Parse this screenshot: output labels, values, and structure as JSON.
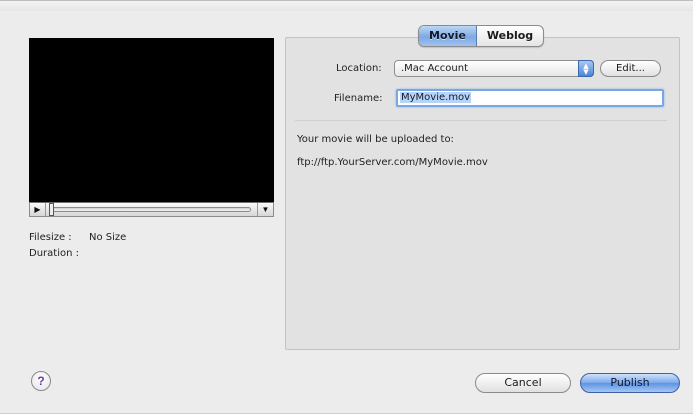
{
  "tabs": [
    {
      "label": "Movie",
      "active": true
    },
    {
      "label": "Weblog",
      "active": false
    }
  ],
  "preview": {
    "play_icon": "play-icon",
    "menu_icon": "triangle-down-icon",
    "filesize_label": "Filesize :",
    "filesize_value": "No Size",
    "duration_label": "Duration :",
    "duration_value": ""
  },
  "form": {
    "location_label": "Location:",
    "location_value": ".Mac Account",
    "edit_label": "Edit...",
    "filename_label": "Filename:",
    "filename_value": "MyMovie.mov"
  },
  "upload": {
    "message": "Your movie will be uploaded to:",
    "url": "ftp://ftp.YourServer.com/MyMovie.mov"
  },
  "footer": {
    "help_label": "?",
    "cancel_label": "Cancel",
    "publish_label": "Publish"
  },
  "colors": {
    "accent": "#7ea9e3",
    "help_glyph": "#6b3fa0"
  }
}
